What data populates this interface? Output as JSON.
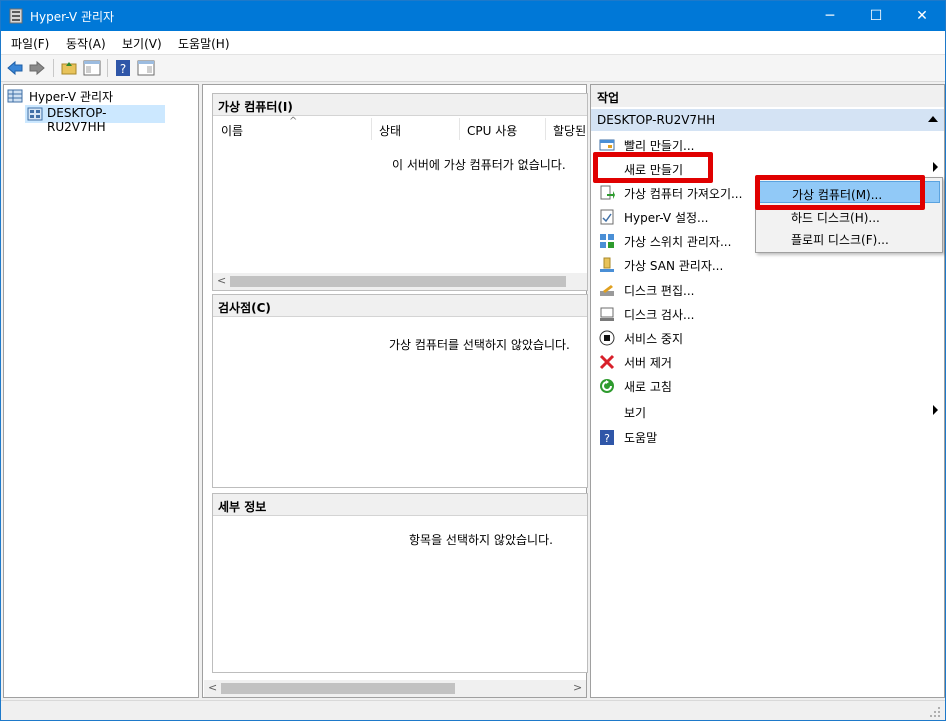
{
  "window": {
    "title": "Hyper-V 관리자",
    "accent": "#0078d7"
  },
  "caption_buttons": {
    "minimize": "─",
    "maximize": "☐",
    "close": "✕"
  },
  "menu": [
    "파일(F)",
    "동작(A)",
    "보기(V)",
    "도움말(H)"
  ],
  "toolbar_icons": [
    "back-icon",
    "forward-icon",
    "up-folder-icon",
    "show-hide-tree-icon",
    "help-icon",
    "action-pane-icon"
  ],
  "tree": {
    "root": "Hyper-V 관리자",
    "server": "DESKTOP-RU2V7HH"
  },
  "virtual_machines": {
    "title": "가상 컴퓨터(I)",
    "columns": [
      "이름",
      "상태",
      "CPU 사용",
      "할당된"
    ],
    "empty_message": "이 서버에 가상 컴퓨터가 없습니다."
  },
  "checkpoints": {
    "title": "검사점(C)",
    "empty_message": "가상 컴퓨터를 선택하지 않았습니다."
  },
  "details": {
    "title": "세부 정보",
    "empty_message": "항목을 선택하지 않았습니다."
  },
  "actions": {
    "header": "작업",
    "group": "DESKTOP-RU2V7HH",
    "items": [
      {
        "label": "빨리 만들기...",
        "icon": "quick-create-icon"
      },
      {
        "label": "새로 만들기",
        "icon": "",
        "submenu": true
      },
      {
        "label": "가상 컴퓨터 가져오기...",
        "icon": "import-vm-icon"
      },
      {
        "label": "Hyper-V 설정...",
        "icon": "settings-icon"
      },
      {
        "label": "가상 스위치 관리자...",
        "icon": "switch-manager-icon"
      },
      {
        "label": "가상 SAN 관리자...",
        "icon": "san-manager-icon"
      },
      {
        "label": "디스크 편집...",
        "icon": "edit-disk-icon"
      },
      {
        "label": "디스크 검사...",
        "icon": "inspect-disk-icon"
      },
      {
        "label": "서비스 중지",
        "icon": "stop-service-icon"
      },
      {
        "label": "서버 제거",
        "icon": "remove-server-icon"
      },
      {
        "label": "새로 고침",
        "icon": "refresh-icon"
      },
      {
        "label": "보기",
        "icon": "",
        "submenu": true
      },
      {
        "label": "도움말",
        "icon": "help-icon"
      }
    ]
  },
  "new_submenu": {
    "items": [
      "가상 컴퓨터(M)...",
      "하드 디스크(H)...",
      "플로피 디스크(F)..."
    ]
  },
  "highlight_color": "#e00000"
}
